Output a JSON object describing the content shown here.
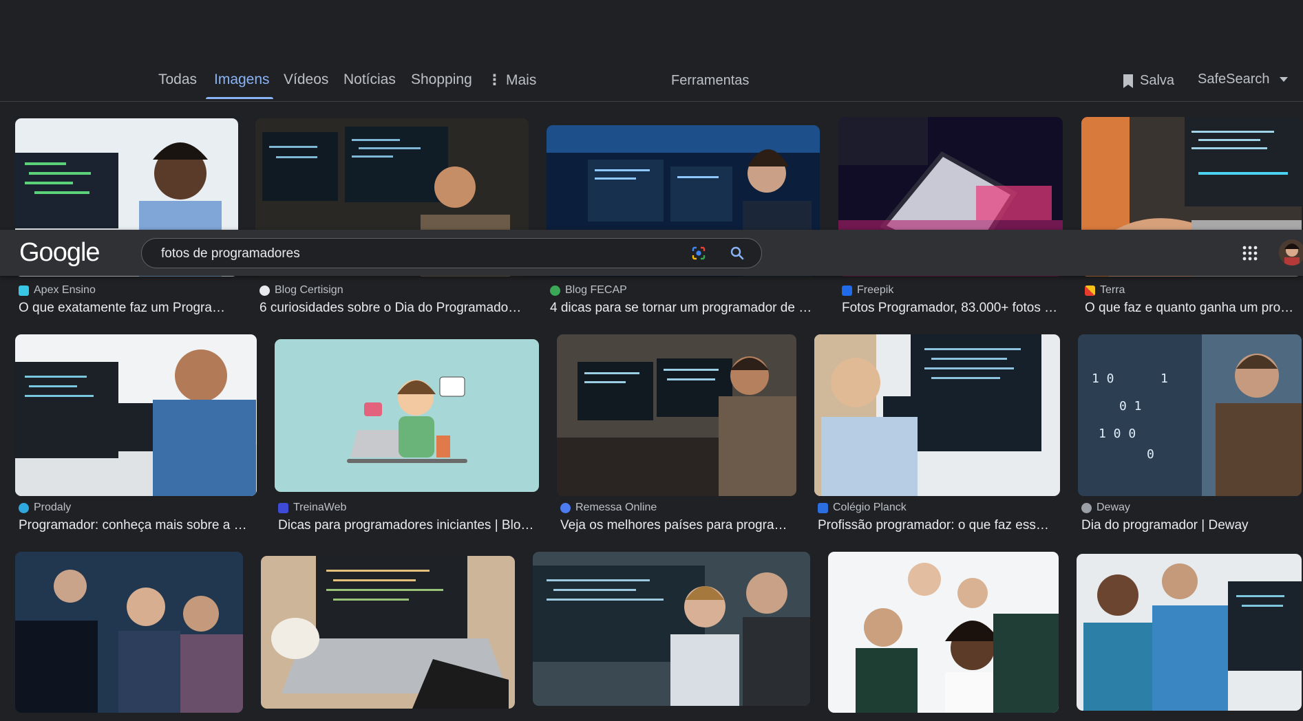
{
  "tabs": {
    "all": "Todas",
    "images": "Imagens",
    "videos": "Vídeos",
    "news": "Notícias",
    "shopping": "Shopping",
    "more": "Mais",
    "tools": "Ferramentas",
    "saved": "Salva",
    "safesearch": "SafeSearch"
  },
  "header": {
    "logo": "Google",
    "query": "fotos de programadores"
  },
  "colors": {
    "background": "#202124",
    "accent": "#8ab4f8",
    "header": "#303134"
  },
  "results": [
    {
      "source": "Apex Ensino",
      "title": "O que exatamente faz um Program..."
    },
    {
      "source": "Blog Certisign",
      "title": "6 curiosidades sobre o Dia do Programador |..."
    },
    {
      "source": "Blog FECAP",
      "title": "4 dicas para se tornar um programador de s..."
    },
    {
      "source": "Freepik",
      "title": "Fotos Programador, 83.000+ fotos d..."
    },
    {
      "source": "Terra",
      "title": "O que faz e quanto ganha um progr..."
    },
    {
      "source": "Prodaly",
      "title": "Programador: conheça mais sobre a pr..."
    },
    {
      "source": "TreinaWeb",
      "title": "Dicas para programadores iniciantes | Blog..."
    },
    {
      "source": "Remessa Online",
      "title": "Veja os melhores países para program..."
    },
    {
      "source": "Colégio Planck",
      "title": "Profissão programador: o que faz esse ..."
    },
    {
      "source": "Deway",
      "title": "Dia do programador | Deway"
    }
  ]
}
